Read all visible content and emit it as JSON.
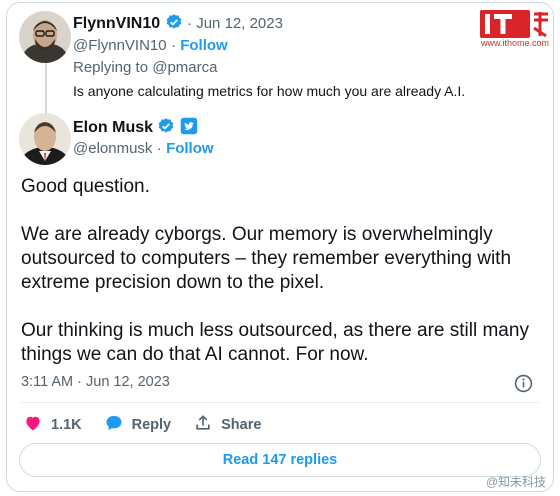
{
  "quoted": {
    "display_name": "FlynnVIN10",
    "date": "Jun 12, 2023",
    "handle": "@FlynnVIN10",
    "follow": "Follow",
    "replying_to": "Replying to @pmarca",
    "text": "Is anyone calculating metrics for how much you are already A.I."
  },
  "tweet": {
    "display_name": "Elon Musk",
    "handle": "@elonmusk",
    "follow": "Follow",
    "paragraphs": [
      "Good question.",
      "We are already cyborgs. Our memory is overwhelmingly outsourced to computers – they remember everything with extreme precision down to the pixel.",
      "Our thinking is much less outsourced, as there are still many things we can do that AI cannot. For now."
    ],
    "timestamp": "3:11 AM · Jun 12, 2023"
  },
  "actions": {
    "likes": "1.1K",
    "reply": "Reply",
    "share": "Share"
  },
  "read_replies": "Read 147 replies",
  "logo": {
    "url": "www.ithome.com"
  },
  "watermark": "@知未科技",
  "colors": {
    "accent": "#1d9bf0",
    "like": "#f91880",
    "border": "#cfd9de",
    "muted": "#536471",
    "text": "#0f1419",
    "logo_red": "#d9242a"
  }
}
